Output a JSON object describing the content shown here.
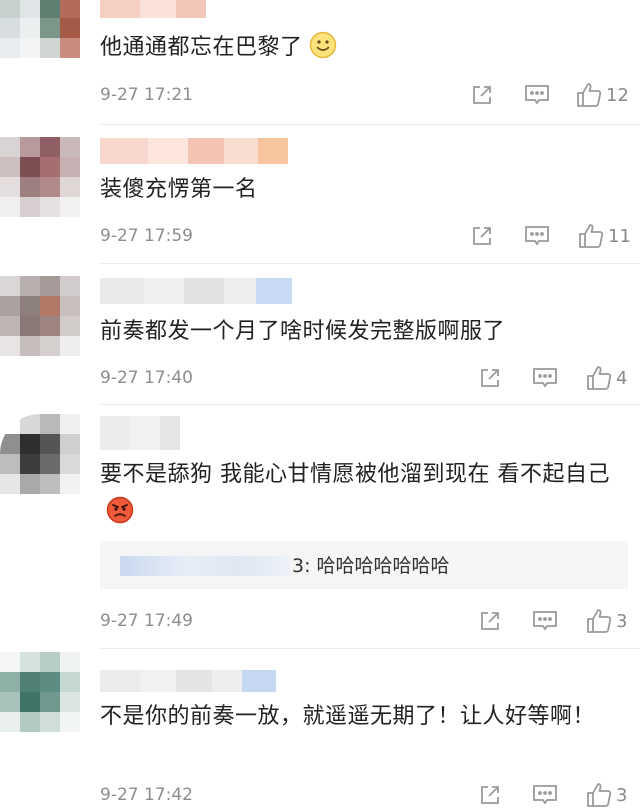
{
  "comments": [
    {
      "text": "他通通都忘在巴黎了",
      "emoji": "smile-emoji",
      "time": "9-27 17:21",
      "likes": "12",
      "avatar_colors": [
        "#8fa3ae",
        "#c6cfd6",
        "#9aa7b0",
        "#e0c7c0",
        "#c9d1cf",
        "#dfe5e7",
        "#5f7f70",
        "#b46b5a",
        "#d7dcde",
        "#eceff0",
        "#7c968a",
        "#a55947",
        "#e9ecee",
        "#f3f4f5",
        "#cfd6d4",
        "#c98b7d"
      ],
      "name_colors": [
        "#f6cfc3",
        "#f9e2d8",
        "#f3c7b8"
      ]
    },
    {
      "text": "装傻充愣第一名",
      "time": "9-27 17:59",
      "likes": "11",
      "avatar_colors": [
        "#d8d4d4",
        "#b89a9c",
        "#8f5f63",
        "#c9b9bb",
        "#cdbfbf",
        "#7f4e52",
        "#a56f72",
        "#c7b0b1",
        "#e3dddd",
        "#9e7f80",
        "#b2898b",
        "#dfd6d6",
        "#f1eeee",
        "#d7cfcf",
        "#e6e0e0",
        "#f3f1f1"
      ],
      "name_colors": [
        "#f9d6cd",
        "#fbe5dd",
        "#f4c2b3",
        "#f8dccf",
        "#f6c49f"
      ]
    },
    {
      "text": "前奏都发一个月了啥时候发完整版啊服了",
      "time": "9-27 17:40",
      "likes": "4",
      "avatar_colors": [
        "#d9d6d5",
        "#b8b0ae",
        "#a59a98",
        "#d2cdcc",
        "#a9a19f",
        "#8c7f7c",
        "#b07865",
        "#c7bfbd",
        "#bdb5b3",
        "#8a7a77",
        "#9c8580",
        "#d1cbca",
        "#e7e4e3",
        "#c6bebc",
        "#d5cfce",
        "#efeded"
      ],
      "name_colors": [
        "#e9e9ea",
        "#f0f0f1",
        "#e2e2e3",
        "#eeeeef",
        "#c7d9f3"
      ]
    },
    {
      "text": "要不是舔狗 我能心甘情愿被他溜到现在 看不起自己",
      "emoji": "angry-emoji",
      "time": "9-27 17:49",
      "likes": "3",
      "reply_text": "3: 哈哈哈哈哈哈哈",
      "avatar_colors": [
        "#ffffff",
        "#d8d8d8",
        "#b9b9b9",
        "#f0f0f0",
        "#8f8f8f",
        "#2f2f2f",
        "#555555",
        "#cfcfcf",
        "#bdbdbd",
        "#3d3d3d",
        "#6b6b6b",
        "#d9d9d9",
        "#e6e6e6",
        "#a9a9a9",
        "#bdbdbd",
        "#f2f2f2"
      ],
      "name_colors": [
        "#ececec",
        "#f2f2f2",
        "#e6e6e6"
      ]
    },
    {
      "text": "不是你的前奏一放，就遥遥无期了！让人好等啊！",
      "time": "9-27 17:42",
      "likes": "3",
      "avatar_colors": [
        "#f3f6f5",
        "#d6e2de",
        "#b7ccc6",
        "#eef3f1",
        "#8fb0a7",
        "#4e8075",
        "#5b8d82",
        "#c7d8d3",
        "#a9c2bb",
        "#3f7468",
        "#6f998f",
        "#dbe6e3",
        "#e8efed",
        "#b3c9c3",
        "#cfdeda",
        "#f1f5f4"
      ],
      "name_colors": [
        "#ececec",
        "#f1f1f1",
        "#e4e4e4",
        "#eeeeee",
        "#c6d7f2"
      ]
    }
  ]
}
